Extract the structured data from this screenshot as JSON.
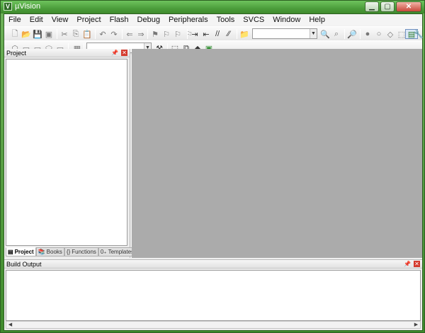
{
  "window": {
    "title": "µVision",
    "app_icon_glyph": "V"
  },
  "menu": [
    "File",
    "Edit",
    "View",
    "Project",
    "Flash",
    "Debug",
    "Peripherals",
    "Tools",
    "SVCS",
    "Window",
    "Help"
  ],
  "panes": {
    "project": {
      "title": "Project",
      "tabs": [
        "Project",
        "Books",
        "Functions",
        "Templates"
      ]
    },
    "build_output": {
      "title": "Build Output"
    }
  },
  "colors": {
    "editor_background": "#ababab",
    "title_bar": "#4c9e3c",
    "close_button": "#d43b2e"
  }
}
